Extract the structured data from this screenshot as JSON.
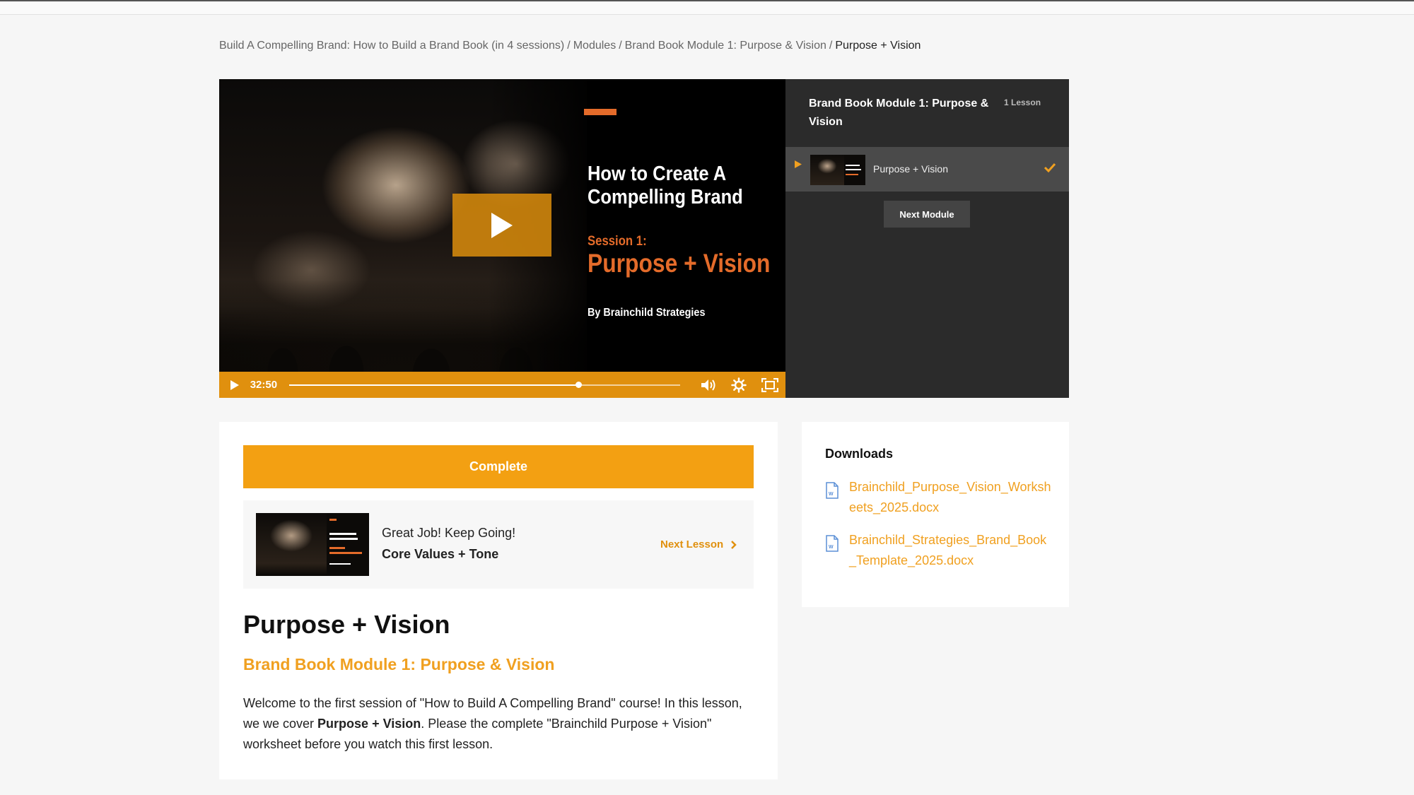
{
  "breadcrumb": {
    "course": "Build A Compelling Brand: How to Build a Brand Book (in 4 sessions)",
    "modules": "Modules",
    "module": "Brand Book Module 1: Purpose & Vision",
    "current": "Purpose + Vision",
    "separator": "/"
  },
  "video": {
    "slide": {
      "title": "How to Create A Compelling Brand",
      "session": "Session 1:",
      "topic": "Purpose + Vision",
      "byline": "By Brainchild Strategies"
    },
    "time": "32:50",
    "progress_fraction": 0.74,
    "icons": {
      "play": "play-icon",
      "volume": "volume-icon",
      "settings": "gear-icon",
      "fullscreen": "fullscreen-icon"
    }
  },
  "sidebar": {
    "module_title": "Brand Book Module 1: Purpose & Vision",
    "lesson_count": "1 Lesson",
    "lessons": [
      {
        "title": "Purpose + Vision",
        "completed": true
      }
    ],
    "next_module_label": "Next Module"
  },
  "lesson": {
    "complete_label": "Complete",
    "next": {
      "message": "Great Job! Keep Going!",
      "title": "Core Values + Tone",
      "link_label": "Next Lesson"
    },
    "title": "Purpose + Vision",
    "module": "Brand Book Module 1: Purpose & Vision",
    "body": {
      "part1": "Welcome to the first session of \"How to Build A Compelling Brand\" course! In this lesson, we we cover ",
      "bold": "Purpose + Vision",
      "part2": ". Please the complete \"Brainchild Purpose + Vision\" worksheet before you watch this first lesson."
    }
  },
  "downloads": {
    "title": "Downloads",
    "files": [
      {
        "name": "Brainchild_Purpose_Vision_Worksheets_2025.docx"
      },
      {
        "name": "Brainchild_Strategies_Brand_Book_Template_2025.docx"
      }
    ]
  },
  "colors": {
    "accent": "#f3a012",
    "slide_orange": "#e46b2a",
    "panel": "#2b2b2b"
  }
}
